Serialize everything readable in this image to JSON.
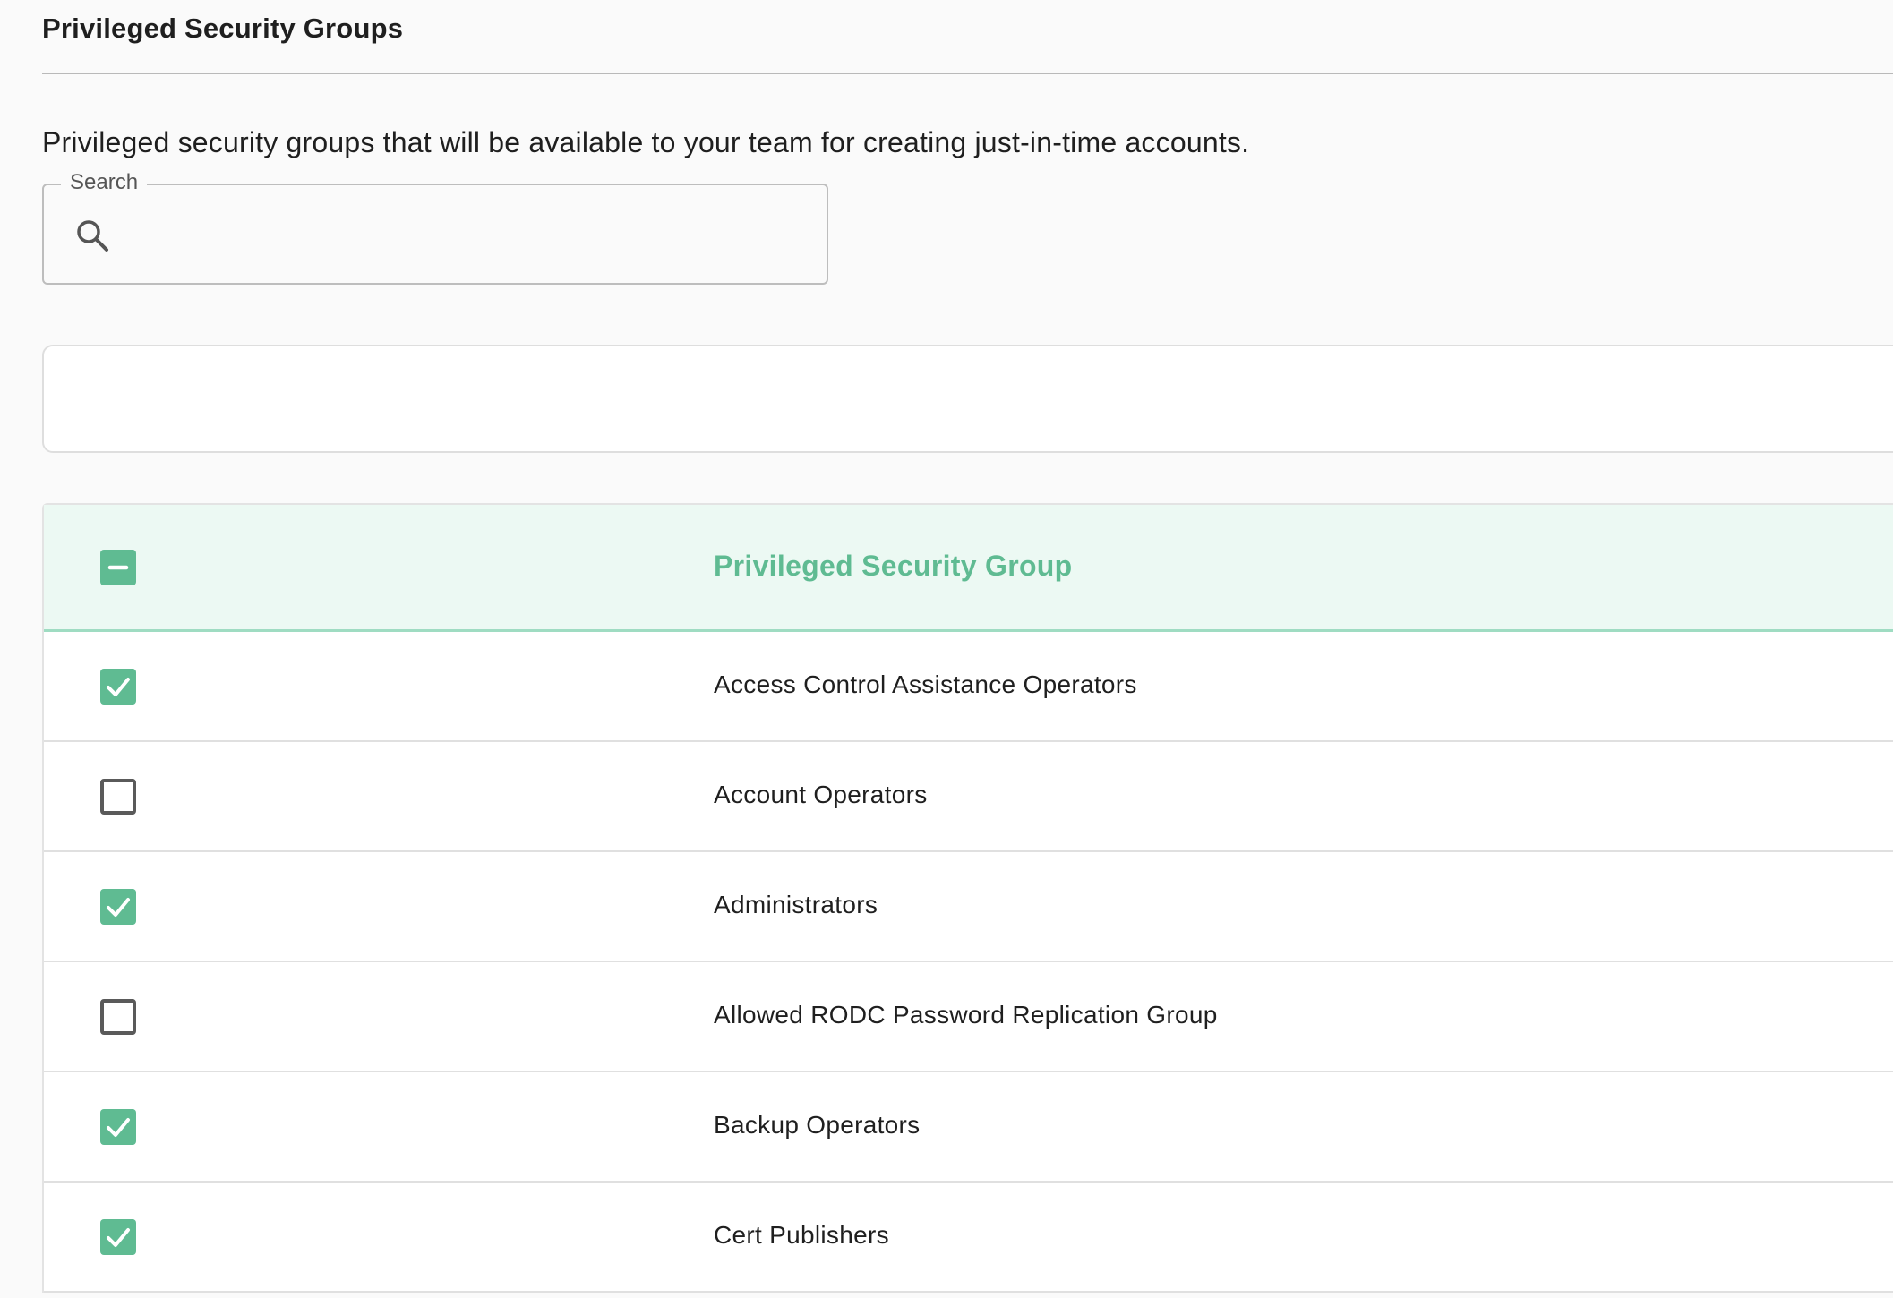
{
  "page": {
    "title": "Privileged Security Groups",
    "description": "Privileged security groups that will be available to your team for creating just-in-time accounts."
  },
  "search": {
    "label": "Search",
    "value": "",
    "icon": "search-icon"
  },
  "colors": {
    "accent": "#5fbb92",
    "header_bg": "#ecf9f3",
    "header_border": "#9fdcc2"
  },
  "table": {
    "header": {
      "select_all_state": "indeterminate",
      "column_label": "Privileged Security Group"
    },
    "rows": [
      {
        "name": "Access Control Assistance Operators",
        "checked": true
      },
      {
        "name": "Account Operators",
        "checked": false
      },
      {
        "name": "Administrators",
        "checked": true
      },
      {
        "name": "Allowed RODC Password Replication Group",
        "checked": false
      },
      {
        "name": "Backup Operators",
        "checked": true
      },
      {
        "name": "Cert Publishers",
        "checked": true
      }
    ]
  }
}
